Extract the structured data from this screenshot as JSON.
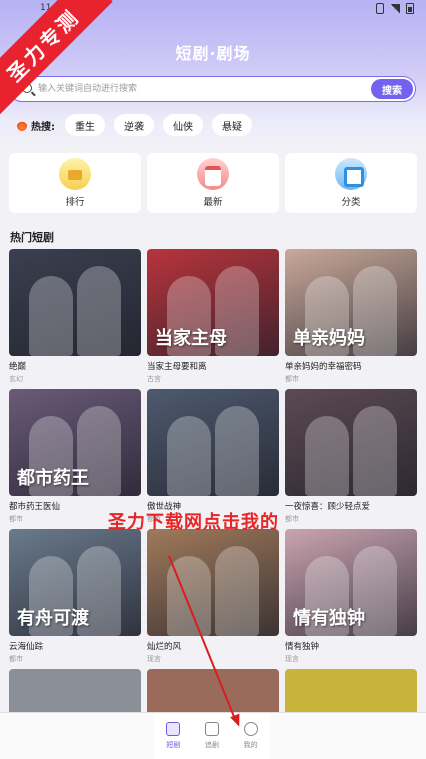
{
  "status_bar": {
    "time": "11:06"
  },
  "badge": {
    "text": "圣力专测"
  },
  "header": {
    "title": "短剧·剧场"
  },
  "search": {
    "placeholder": "输入关键词自动进行搜索",
    "button_label": "搜索"
  },
  "hot": {
    "label": "热搜:",
    "tags": [
      "重生",
      "逆袭",
      "仙侠",
      "悬疑"
    ]
  },
  "categories": [
    {
      "label": "排行",
      "icon": "ranking-icon"
    },
    {
      "label": "最新",
      "icon": "calendar-icon"
    },
    {
      "label": "分类",
      "icon": "category-icon"
    }
  ],
  "section": {
    "title": "热门短剧"
  },
  "dramas": [
    {
      "title": "绝巅",
      "genre": "玄幻",
      "poster_color": "#3a4050",
      "poster_text": ""
    },
    {
      "title": "当家主母要和离",
      "genre": "古言",
      "poster_color": "#b8343c",
      "poster_text": "当家主母"
    },
    {
      "title": "单亲妈妈的幸福密码",
      "genre": "都市",
      "poster_color": "#c9a99a",
      "poster_text": "单亲妈妈"
    },
    {
      "title": "都市药王医仙",
      "genre": "都市",
      "poster_color": "#6b5a78",
      "poster_text": "都市药王"
    },
    {
      "title": "傲世战神",
      "genre": "都市",
      "poster_color": "#4d5a6e",
      "poster_text": ""
    },
    {
      "title": "一夜惊喜：顾少轻点爱",
      "genre": "都市",
      "poster_color": "#5c4a52",
      "poster_text": ""
    },
    {
      "title": "云海仙踪",
      "genre": "都市",
      "poster_color": "#6a7a8c",
      "poster_text": "有舟可渡"
    },
    {
      "title": "灿烂的风",
      "genre": "现言",
      "poster_color": "#a07a5a",
      "poster_text": ""
    },
    {
      "title": "情有独钟",
      "genre": "现言",
      "poster_color": "#caa4b0",
      "poster_text": "情有独钟"
    }
  ],
  "watermark": {
    "text": "圣力下载网点击我的"
  },
  "bottom_nav": [
    {
      "label": "短剧",
      "active": true
    },
    {
      "label": "追剧",
      "active": false
    },
    {
      "label": "我的",
      "active": false
    }
  ],
  "colors": {
    "accent": "#7361f0",
    "badge": "#e8232f",
    "watermark": "#e62626"
  }
}
